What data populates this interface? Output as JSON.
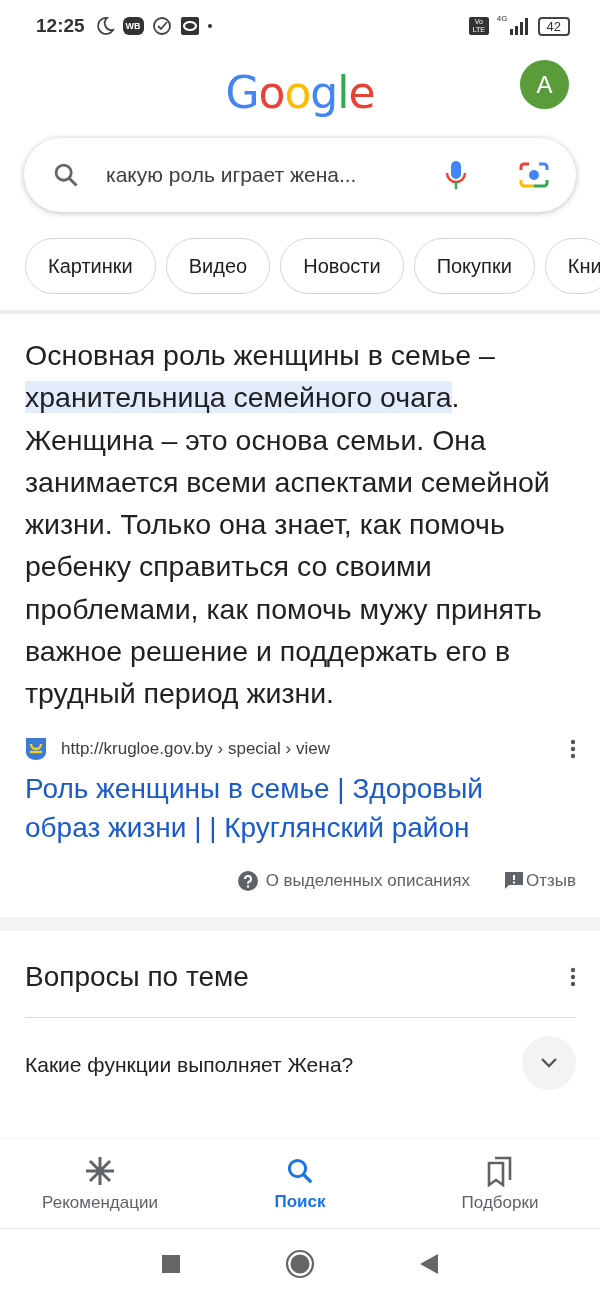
{
  "status_bar": {
    "time": "12:25",
    "badge": "WB",
    "volte": "Vo LTE",
    "network": "4G",
    "battery": "42"
  },
  "header": {
    "logo": "Google",
    "avatar": "A"
  },
  "search": {
    "value": "какую роль играет жена..."
  },
  "chips": [
    {
      "label": "Картинки"
    },
    {
      "label": "Видео"
    },
    {
      "label": "Новости"
    },
    {
      "label": "Покупки"
    },
    {
      "label": "Кни"
    }
  ],
  "answer": {
    "text": "Основная роль женщины в семье – **хранительница семейного очага**. Женщина – это основа семьи. Она занимается всеми аспектами семейной жизни. Только она знает, как помочь ребенку справиться со своими проблемами, как помочь мужу принять важное решение и поддержать его в трудный период жизни.",
    "source_url": "http://krugloe.gov.by › special › view",
    "title": "Роль женщины в семье | Здоровый образ жизни | | Круглянский район",
    "about": "О выделенных описаниях",
    "feedback": "Отзыв"
  },
  "related": {
    "title": "Вопросы по теме",
    "questions": [
      {
        "text": "Какие функции выполняет Жена?",
        "expanded": false
      }
    ]
  },
  "bottom_nav": [
    {
      "label": "Рекомендации",
      "selected": false
    },
    {
      "label": "Поиск",
      "selected": true
    },
    {
      "label": "Подборки",
      "selected": false
    }
  ]
}
